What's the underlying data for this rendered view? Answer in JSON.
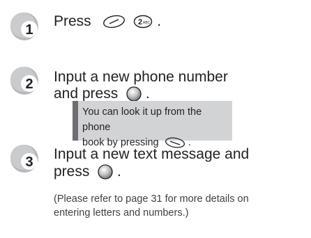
{
  "steps": [
    {
      "number": "1",
      "text_before": "Press",
      "text_after": "."
    },
    {
      "number": "2",
      "line1": "Input a new phone number",
      "line2_before": "and press",
      "line2_after": "."
    },
    {
      "number": "3",
      "line1": "Input a new text message and",
      "line2_before": "press",
      "line2_after": "."
    }
  ],
  "note": {
    "line1": "You can look it up from the phone",
    "line2_before": "book by pressing",
    "line2_after": "."
  },
  "footnote": {
    "line1": "(Please refer to page 31 for more details on",
    "line2": "entering letters and numbers.)"
  },
  "key_2_label": "2ABC",
  "icons": {
    "menu_key": "menu-key-icon",
    "number_key": "number-2-key-icon",
    "ok_key": "ok-button-icon",
    "phonebook_key": "phonebook-key-icon"
  },
  "colors": {
    "badge_gray": "#a7a9ac",
    "badge_white": "#ffffff",
    "text": "#231f20",
    "note_bg": "#d2d3d5",
    "note_bar": "#6d6e71"
  }
}
